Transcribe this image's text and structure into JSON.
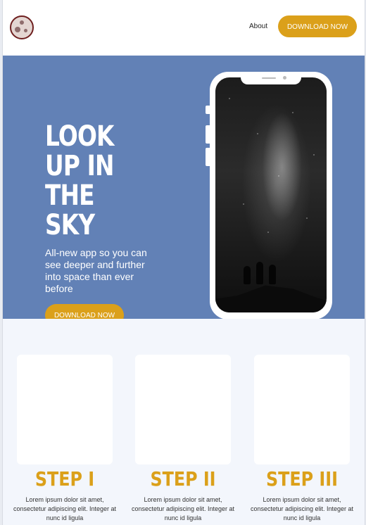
{
  "header": {
    "nav_about": "About",
    "download_label": "DOWNLOAD NOW"
  },
  "hero": {
    "title_lines": [
      "LOOK",
      "UP IN",
      "THE",
      "SKY"
    ],
    "subtitle": "All-new app so you can see deeper and further into space than ever before",
    "cta_label": "DOWNLOAD NOW"
  },
  "steps": [
    {
      "title": "STEP I",
      "text": "Lorem ipsum dolor sit amet, consectetur adipiscing elit. Integer at nunc id ligula"
    },
    {
      "title": "STEP II",
      "text": "Lorem ipsum dolor sit amet, consectetur adipiscing elit. Integer at nunc id ligula"
    },
    {
      "title": "STEP III",
      "text": "Lorem ipsum dolor sit amet, consectetur adipiscing elit. Integer at nunc id ligula"
    }
  ],
  "colors": {
    "accent": "#dba01a",
    "hero_bg": "#6281b6",
    "page_bg": "#f3f6fc",
    "logo_ring": "#6e1f1f"
  },
  "icons": {
    "logo": "moon-logo-icon"
  }
}
